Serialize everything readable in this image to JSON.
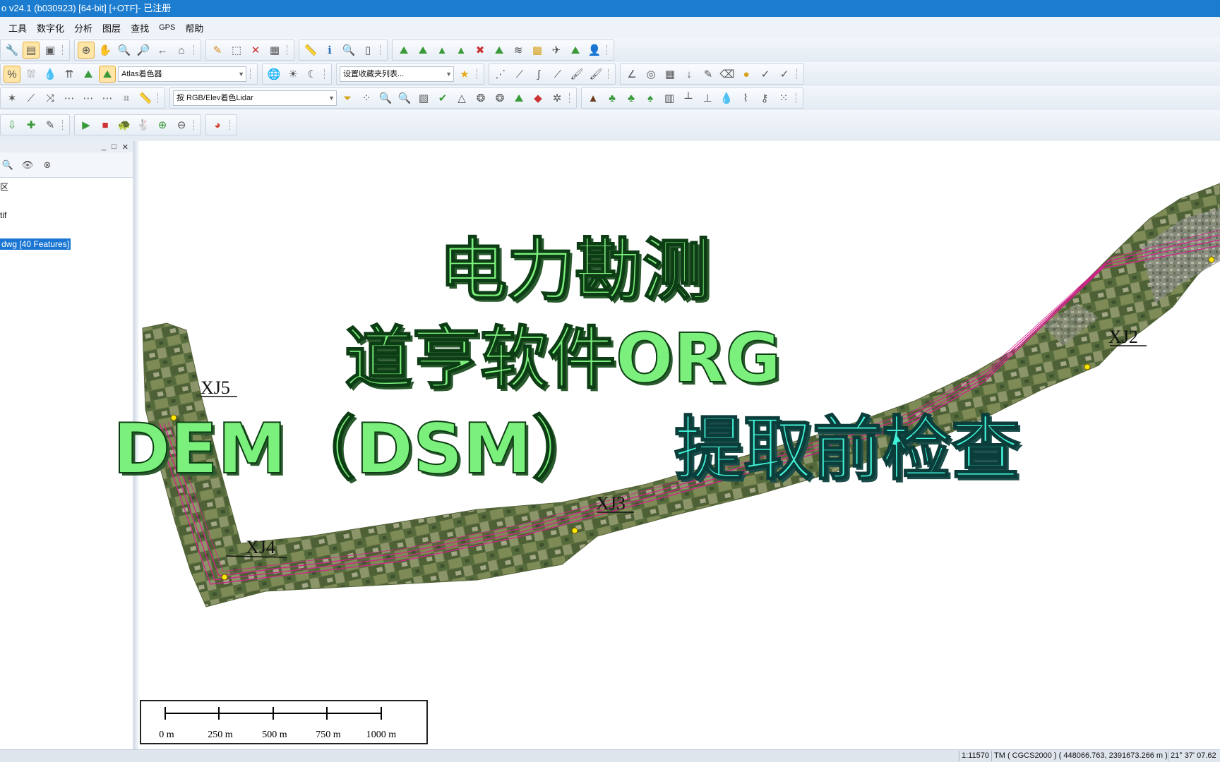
{
  "window": {
    "title": "o v24.1 (b030923) [64-bit] [+OTF]- 已注册"
  },
  "menu": [
    {
      "label": "工具",
      "small": false
    },
    {
      "label": "数字化",
      "small": false
    },
    {
      "label": "分析",
      "small": false
    },
    {
      "label": "图层",
      "small": false
    },
    {
      "label": "查找",
      "small": false
    },
    {
      "label": "GPS",
      "small": true
    },
    {
      "label": "帮助",
      "small": false
    }
  ],
  "toolbar": {
    "shader_combo": "Atlas着色器",
    "favorites_combo": "设置收藏夹列表...",
    "lidar_color_combo": "按 RGB/Elev着色Lidar"
  },
  "control_center": {
    "layers": [
      {
        "label": "区",
        "selected": false
      },
      {
        "label": "tif",
        "selected": false
      },
      {
        "label": "dwg [40 Features]",
        "selected": true
      }
    ]
  },
  "map": {
    "point_labels": [
      "XJ2",
      "XJ3",
      "XJ4",
      "XJ5"
    ],
    "overlay_lines": [
      "电力勘测",
      "道亨软件ORG",
      "DEM（DSM）",
      "提取前检查"
    ],
    "scale_labels": [
      "0 m",
      "250 m",
      "500 m",
      "750 m",
      "1000 m"
    ],
    "route_color": "#d4208c",
    "marker_color": "#ffe600"
  },
  "status": {
    "scale": "1:11570",
    "projection": "TM ( CGCS2000 ) ( 448066.763, 2391673.266 m )",
    "coords": "21° 37' 07.62"
  }
}
